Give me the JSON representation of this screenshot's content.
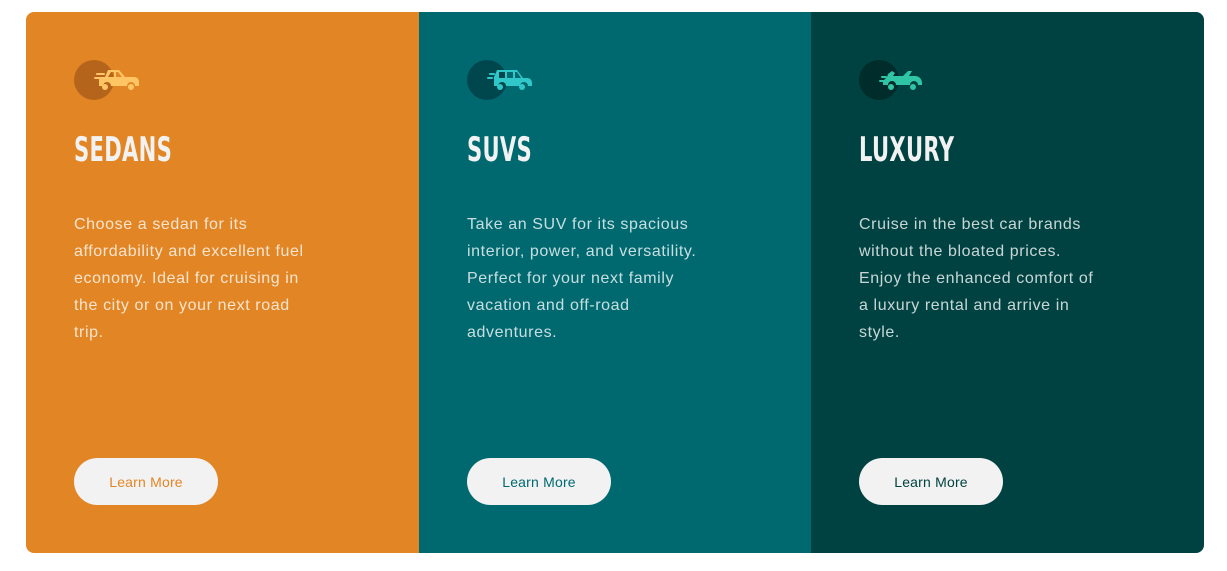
{
  "cards": [
    {
      "icon": "sedan-car-icon",
      "title": "SEDANS",
      "description": "Choose a sedan for its affordability and excellent fuel economy. Ideal for cruising in the city or on your next road trip.",
      "button_label": "Learn More",
      "colors": {
        "background": "#e28625",
        "circle": "#b5641b",
        "icon": "#ffc565",
        "button_text": "#e28625"
      }
    },
    {
      "icon": "suv-car-icon",
      "title": "SUVS",
      "description": "Take an SUV for its spacious interior, power, and versatility. Perfect for your next family vacation and off-road adventures.",
      "button_label": "Learn More",
      "colors": {
        "background": "#006970",
        "circle": "#00474d",
        "icon": "#2fc7c7",
        "button_text": "#006970"
      }
    },
    {
      "icon": "luxury-car-icon",
      "title": "LUXURY",
      "description": "Cruise in the best car brands without the bloated prices. Enjoy the enhanced comfort of a luxury rental and arrive in style.",
      "button_label": "Learn More",
      "colors": {
        "background": "#004241",
        "circle": "#002c2b",
        "icon": "#2ec6a4",
        "button_text": "#004241"
      }
    }
  ]
}
